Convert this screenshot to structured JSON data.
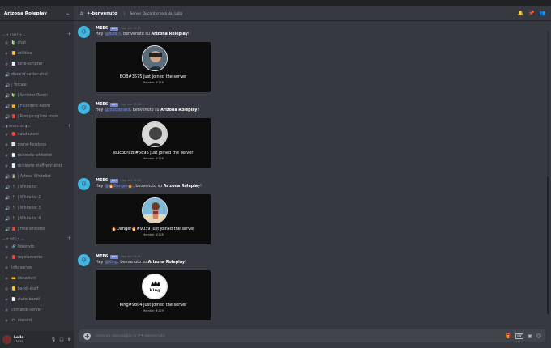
{
  "server": {
    "name": "Arizona Roleplay",
    "sub": "· · · · · · · ·"
  },
  "categories": [
    {
      "label": "— ✦ STAFF ✦ —",
      "index": 0
    },
    {
      "label": "— ▮ WHITELIST ▮ —",
      "index": 1
    },
    {
      "label": "— ✦ INFO ✦ —",
      "index": 2
    }
  ],
  "channels_staff": [
    {
      "emo": "🔰",
      "label": "chat",
      "type": "text"
    },
    {
      "emo": "📒",
      "label": "utilities",
      "type": "text"
    },
    {
      "emo": "📄",
      "label": "note-scripter",
      "type": "text"
    },
    {
      "emo": "",
      "label": "discord-setter-chat",
      "type": "voice"
    },
    {
      "emo": "",
      "label": "| Vocale",
      "type": "voice"
    },
    {
      "emo": "🔰",
      "label": "| Scripter Room",
      "type": "voice"
    },
    {
      "emo": "👑",
      "label": "| Founders Room",
      "type": "voice"
    },
    {
      "emo": "📕",
      "label": "| Rompicoglioni room",
      "type": "voice"
    }
  ],
  "channels_whitelist": [
    {
      "emo": "🔴",
      "label": "valutazioni",
      "type": "text"
    },
    {
      "emo": "⬜",
      "label": "come-funziona",
      "type": "text"
    },
    {
      "emo": "📄",
      "label": "richieste-whitelist",
      "type": "text"
    },
    {
      "emo": "📄",
      "label": "richieste-staff-whitelist",
      "type": "text"
    },
    {
      "emo": "⌛",
      "label": "| Attesa Whitelist",
      "type": "voice"
    },
    {
      "emo": "🕴",
      "label": "| Whitelist",
      "type": "voice"
    },
    {
      "emo": "🕴",
      "label": "| Whitelist 2",
      "type": "voice"
    },
    {
      "emo": "🕴",
      "label": "| Whitelist 3",
      "type": "voice"
    },
    {
      "emo": "🕴",
      "label": "| Whitelist 4",
      "type": "voice"
    },
    {
      "emo": "📕",
      "label": "| Fine whitelist",
      "type": "voice"
    }
  ],
  "channels_info": [
    {
      "emo": "🔗",
      "label": "tokenvip",
      "type": "text"
    },
    {
      "emo": "📕",
      "label": "regolamento",
      "type": "text"
    },
    {
      "emo": "",
      "label": "info-server",
      "type": "text"
    },
    {
      "emo": "💳",
      "label": "donazioni",
      "type": "text"
    },
    {
      "emo": "📒",
      "label": "bandi-staff",
      "type": "text"
    },
    {
      "emo": "📄",
      "label": "stato-bandi",
      "type": "text"
    },
    {
      "emo": "",
      "label": "comandi-server",
      "type": "text"
    },
    {
      "emo": "🎮",
      "label": "discord",
      "type": "text"
    }
  ],
  "user": {
    "name": "Lollo",
    "tag": "#5839"
  },
  "channel": {
    "name": "✦-benvenuto",
    "topic": "Server Discord creato da: Lollo"
  },
  "messages": [
    {
      "author": "MEE6",
      "bot_label": "BOT",
      "time": "Oggi alle 18:45",
      "greeting": "Hey ",
      "mention": "@BOB ?",
      "middle": ", benvenuto su ",
      "server": "Arizona Roleplay",
      "end": "!",
      "card_title": "BOB#3575 just joined the server",
      "card_sub": "Member #128",
      "avatar": "bob"
    },
    {
      "author": "MEE6",
      "bot_label": "BOT",
      "time": "Oggi alle 17:16",
      "greeting": "Hey ",
      "mention": "@loucobrazil",
      "middle": ", benvenuto su ",
      "server": "Arizona Roleplay",
      "end": "!",
      "card_title": "loucobrazil#6896 just joined the server",
      "card_sub": "Member #128",
      "avatar": "lou"
    },
    {
      "author": "MEE6",
      "bot_label": "BOT",
      "time": "Oggi alle 11:03",
      "greeting": "Hey ",
      "mention": "@🔥Danger🔥",
      "middle": ", benvenuto su ",
      "server": "Arizona Roleplay",
      "end": "!",
      "card_title": "🔥Danger🔥#9039 just joined the server",
      "card_sub": "Member #128",
      "avatar": "danger"
    },
    {
      "author": "MEE6",
      "bot_label": "BOT",
      "time": "Oggi alle 19:41",
      "greeting": "Hey ",
      "mention": "@King",
      "middle": ", benvenuto su ",
      "server": "Arizona Roleplay",
      "end": "!",
      "card_title": "King#9804 just joined the server",
      "card_sub": "Member #129",
      "avatar": "king",
      "avatar_text": "King"
    }
  ],
  "input": {
    "placeholder": "Invia un messaggio in #✦-benvenuto",
    "gif_label": "GIF"
  },
  "icons": {
    "header": [
      "bell-icon",
      "pin-icon",
      "members-icon"
    ],
    "input": [
      "gift-icon",
      "gif-icon",
      "sticker-icon",
      "emoji-icon"
    ],
    "user": [
      "mic-icon",
      "headphones-icon",
      "settings-icon"
    ]
  },
  "colors": {
    "accent": "#7289da",
    "mee6": "#43b5e0",
    "bot_badge": "#7289da"
  }
}
